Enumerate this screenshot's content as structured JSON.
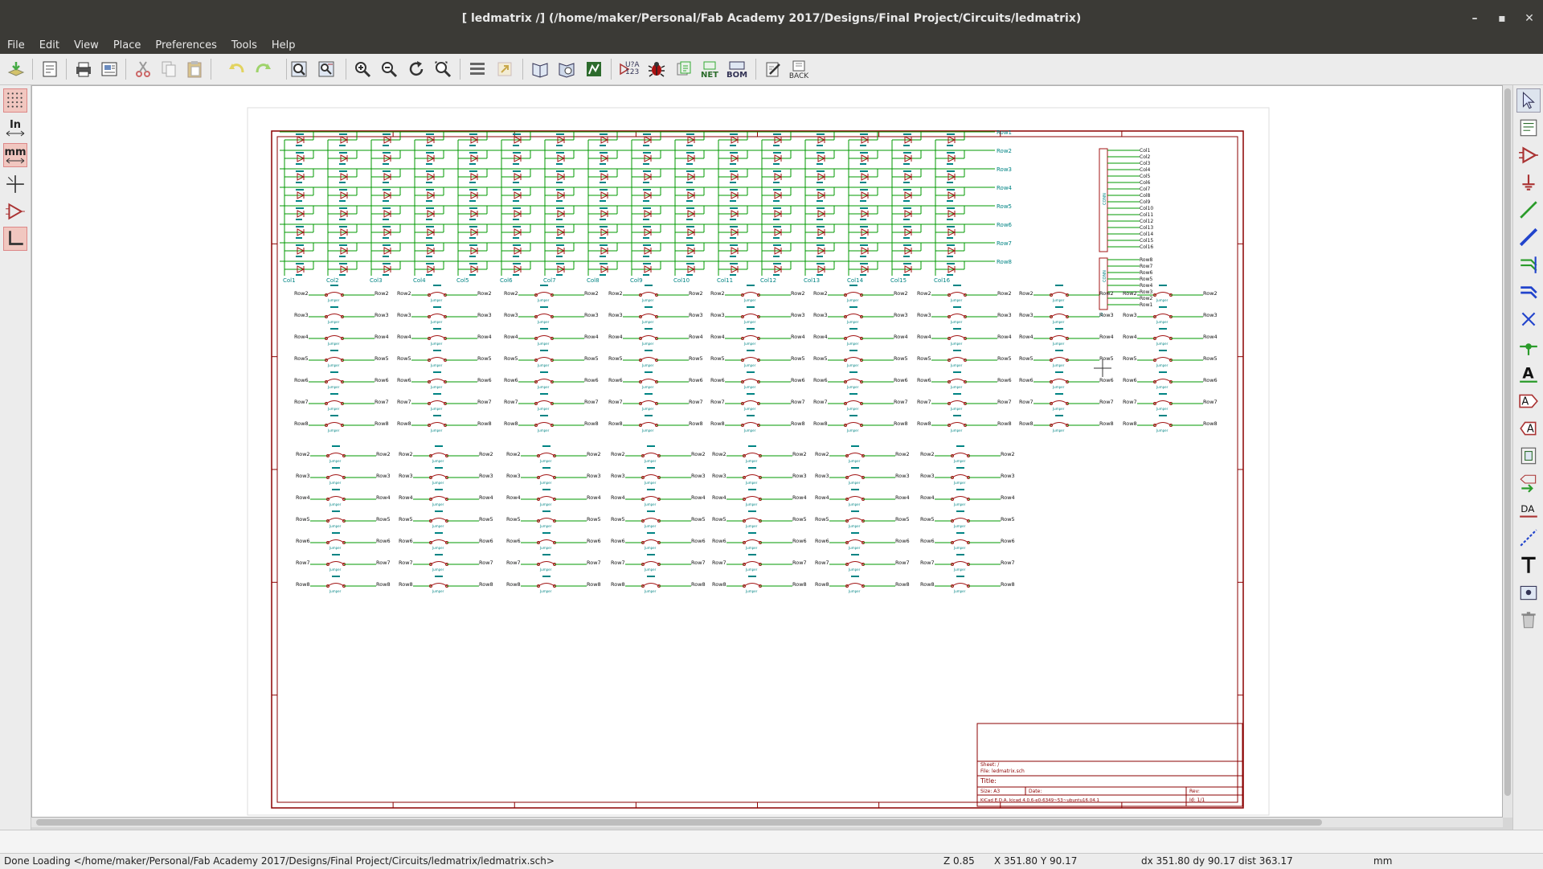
{
  "window": {
    "title": "[ ledmatrix /] (/home/maker/Personal/Fab Academy 2017/Designs/Final Project/Circuits/ledmatrix)",
    "controls": {
      "minimize": "–",
      "maximize": "▪",
      "close": "✕"
    }
  },
  "menu": [
    "File",
    "Edit",
    "View",
    "Place",
    "Preferences",
    "Tools",
    "Help"
  ],
  "toolbar": {
    "icons": [
      "new-schematic-icon",
      "page-settings-icon",
      "print-icon",
      "plot-icon",
      "cut-icon",
      "copy-icon",
      "paste-icon",
      "undo-icon",
      "redo-icon",
      "find-icon",
      "find-replace-icon",
      "zoom-in-icon",
      "zoom-out-icon",
      "redraw-icon",
      "zoom-fit-icon",
      "hierarchy-navigator-icon",
      "leave-sheet-icon",
      "library-editor-icon",
      "library-browser-icon",
      "netlist-icon",
      "annotate-icon",
      "erc-icon",
      "footprint-assign-icon",
      "generate-netlist-icon",
      "bom-icon",
      "edit-pcb-icon",
      "back-annotate-icon"
    ],
    "annotate_label": "U?A 123",
    "net_label": "NET",
    "bom_label": "BOM",
    "back_label": "BACK"
  },
  "left_toolbar": {
    "grid_icon": "grid-icon",
    "inch_label": "In",
    "mm_label": "mm",
    "cursor_icon": "full-cursor-icon",
    "hidden_pins_icon": "hidden-pins-icon",
    "orthogonal_icon": "orthogonal-wires-icon"
  },
  "right_toolbar": [
    "select-arrow-icon",
    "hierarchy-icon",
    "place-component-icon",
    "place-power-icon",
    "wire-icon",
    "bus-icon",
    "wire-bus-entry-icon",
    "bus-bus-entry-icon",
    "no-connect-icon",
    "junction-icon",
    "net-label-icon",
    "global-label-icon",
    "hierarchical-label-icon",
    "hierarchical-sheet-icon",
    "import-sheet-pin-icon",
    "sheet-pin-icon",
    "graphic-line-icon",
    "text-icon",
    "image-icon",
    "delete-icon"
  ],
  "schematic": {
    "led_matrix": {
      "rows": [
        "Row1",
        "Row2",
        "Row3",
        "Row4",
        "Row5",
        "Row6",
        "Row7",
        "Row8"
      ],
      "cols": [
        "Col1",
        "Col2",
        "Col3",
        "Col4",
        "Col5",
        "Col6",
        "Col7",
        "Col8",
        "Col9",
        "Col10",
        "Col11",
        "Col12",
        "Col13",
        "Col14",
        "Col15",
        "Col16"
      ]
    },
    "connector_j2": {
      "ref_a": "CONN",
      "ref_b": "CONN",
      "ref_bottom": "J2",
      "col_labels": [
        "Col1",
        "Col2",
        "Col3",
        "Col4",
        "Col5",
        "Col6",
        "Col7",
        "Col8",
        "Col9",
        "Col10",
        "Col11",
        "Col12",
        "Col13",
        "Col14",
        "Col15",
        "Col16"
      ],
      "row_labels": [
        "Row8",
        "Row7",
        "Row6",
        "Row5",
        "Row4",
        "Row3",
        "Row2",
        "Row1"
      ]
    },
    "jumper_rows": [
      "Row2",
      "Row3",
      "Row4",
      "Row5",
      "Row6",
      "Row7",
      "Row8"
    ],
    "jumper_value": "Jumper",
    "title_block": {
      "sheet": "Sheet: /",
      "file": "File: ledmatrix.sch",
      "title": "Title:",
      "size": "Size: A3",
      "date": "Date:",
      "rev": "Rev:",
      "kicad": "KiCad E.D.A.  kicad 4.0.6-e0-6349~53~ubuntu16.04.1",
      "id": "Id: 1/1"
    }
  },
  "message_bar": "",
  "status": {
    "message": "Done Loading </home/maker/Personal/Fab Academy 2017/Designs/Final Project/Circuits/ledmatrix/ledmatrix.sch>",
    "zoom": "Z 0.85",
    "coords": "X 351.80  Y 90.17",
    "delta": "dx 351.80  dy 90.17  dist 363.17",
    "units": "mm"
  },
  "colors": {
    "chrome": "#3b3a36",
    "border": "#8b0000",
    "wire": "#009900",
    "component": "#a31515",
    "text": "#008484"
  }
}
